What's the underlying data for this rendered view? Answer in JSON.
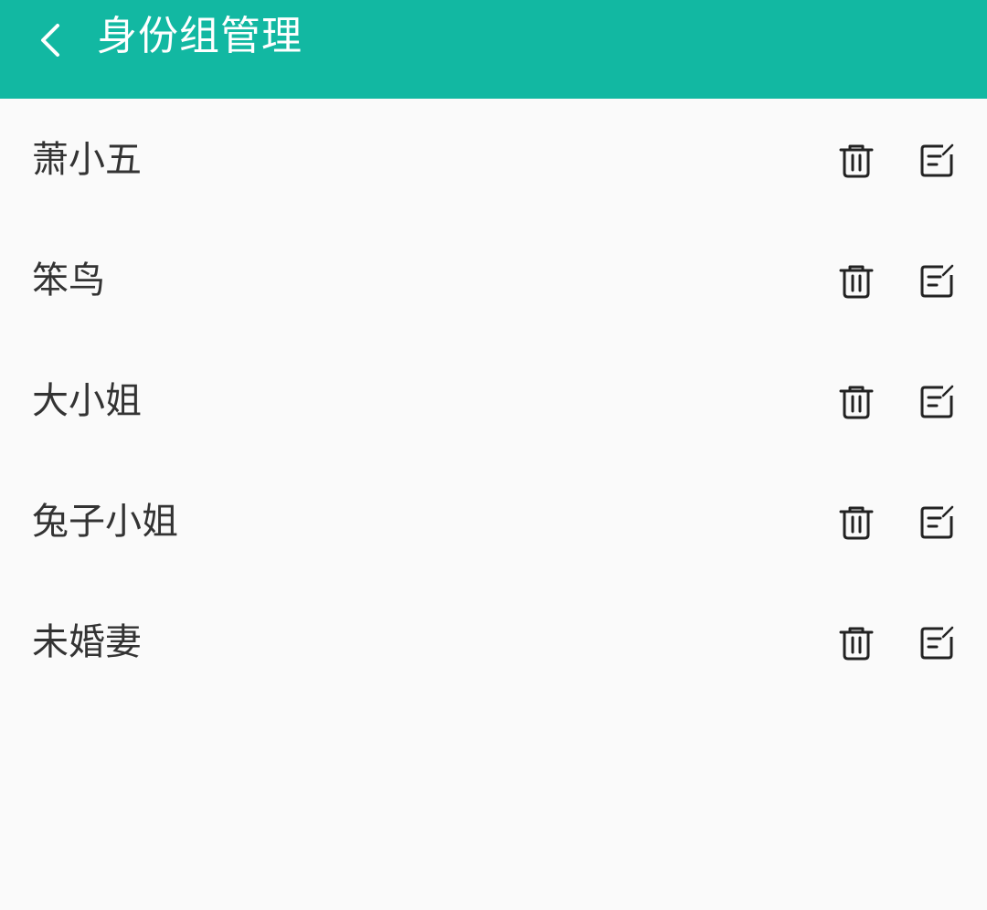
{
  "header": {
    "title": "身份组管理",
    "back_icon": "chevron-left-icon",
    "background_color": "#12b8a2"
  },
  "groups": [
    {
      "name": "萧小五",
      "delete_icon": "trash-icon",
      "edit_icon": "edit-icon"
    },
    {
      "name": "笨鸟",
      "delete_icon": "trash-icon",
      "edit_icon": "edit-icon"
    },
    {
      "name": "大小姐",
      "delete_icon": "trash-icon",
      "edit_icon": "edit-icon"
    },
    {
      "name": "兔子小姐",
      "delete_icon": "trash-icon",
      "edit_icon": "edit-icon"
    },
    {
      "name": "未婚妻",
      "delete_icon": "trash-icon",
      "edit_icon": "edit-icon"
    }
  ]
}
